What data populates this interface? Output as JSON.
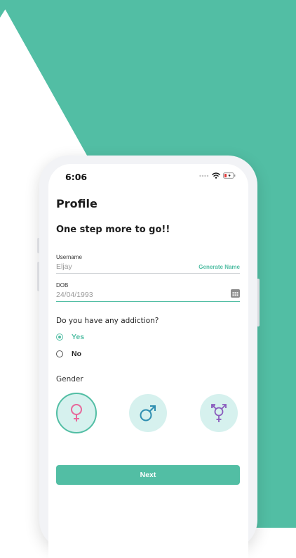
{
  "colors": {
    "accent": "#52bea4",
    "gender_circle": "#d6f1ee",
    "female": "#e8679a",
    "male": "#2e8eb0",
    "transgender": "#8a5bbd"
  },
  "status_bar": {
    "time": "6:06"
  },
  "header": {
    "title": "Profile",
    "subtitle": "One step more to go!!"
  },
  "form": {
    "username": {
      "label": "Username",
      "value": "Eljay",
      "action": "Generate Name"
    },
    "dob": {
      "label": "DOB",
      "value": "24/04/1993",
      "icon": "calendar-icon"
    }
  },
  "addiction": {
    "question": "Do you have any addiction?",
    "options": [
      {
        "label": "Yes",
        "selected": true
      },
      {
        "label": "No",
        "selected": false
      }
    ]
  },
  "gender": {
    "label": "Gender",
    "options": [
      {
        "icon": "female-icon",
        "selected": true
      },
      {
        "icon": "male-icon",
        "selected": false
      },
      {
        "icon": "transgender-icon",
        "selected": false
      }
    ]
  },
  "next_button": {
    "label": "Next"
  }
}
